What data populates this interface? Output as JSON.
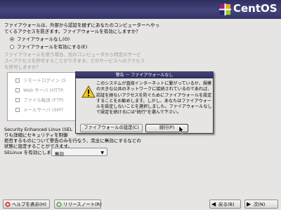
{
  "header": {
    "brand": "CentOS"
  },
  "firewall": {
    "intro_line1": "ファイアウォールは、外部から認証を経ずにあなたのコンピューターへやっ",
    "intro_line2": "てくるアクセスを防ぎます。ファイアウォールを有効にしますか？",
    "option_off": "ファイアウォールなし(O)",
    "option_on": "ファイアウォールを有効にする(E)",
    "desc_line1": "ファイアウォールを使う場合、別のコンピュータから特定のサービ",
    "desc_line2": "スへアクセスを許可することができます。どのサービスへのアクセス",
    "desc_line3": "を許可しますか？",
    "services": [
      {
        "label": "リモートログイン (S"
      },
      {
        "label": "Web サーバ (HTTP,"
      },
      {
        "label": "ファイル転送 (FTP)"
      },
      {
        "label": "メールサーバ (SMT"
      }
    ]
  },
  "selinux": {
    "desc_line1": "Security Enhanced Linux (SEL",
    "desc_line2": "りも詳細にセキュリティを制御",
    "desc_line3": "拒否するものについて警告のみを行なう、完全に無効にするなどの",
    "desc_line4": "状態に設定することができます。",
    "prompt": "SELinux を有効にしますか？(S):",
    "value": "無効"
  },
  "dialog": {
    "title": "警告 － ファイアウォールなし",
    "message": "このシステムが直接インターネットに繋がっているか、規模の大きな公共のネットワークに接続されているのであれば、認証を経ないアクセスを防ぐためにファイアウォールを設定することをお勧めします。しかし、あなたはファイアウォールを設定しないことを選択しました。ファイアウォールなしで設定を続けるには\"続行\"を選んで下さい。",
    "configure_button": "ファイアウォールの設定(C)",
    "proceed_button": "続行(P)"
  },
  "footer": {
    "help_button": "ヘルプを表示(H)",
    "release_notes_button": "リリースノート(R)",
    "back_button": "戻る(B)",
    "next_button": "次(N)"
  },
  "colors": {
    "header_bg": "#3a3a70",
    "window_bg": "#e6e5e3"
  }
}
